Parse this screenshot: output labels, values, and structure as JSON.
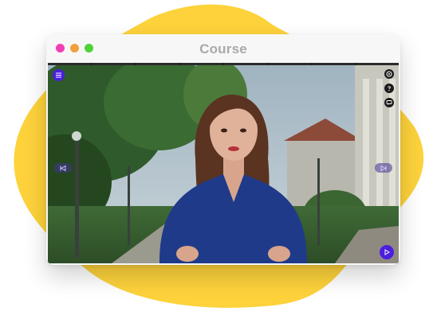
{
  "window": {
    "title": "Course"
  },
  "colors": {
    "accent": "#4b1fdd",
    "blob": "#fdd23b",
    "dot_close": "#f33fb6",
    "dot_min": "#f2a03d",
    "dot_max": "#4fd335"
  },
  "controls": {
    "menu_icon": "menu-icon",
    "settings_icon": "settings-icon",
    "help_icon": "help-icon",
    "caption_icon": "speech-bubble-icon",
    "prev_icon": "skip-back-icon",
    "next_icon": "skip-forward-icon",
    "play_icon": "play-icon"
  },
  "progress_segments": 8
}
